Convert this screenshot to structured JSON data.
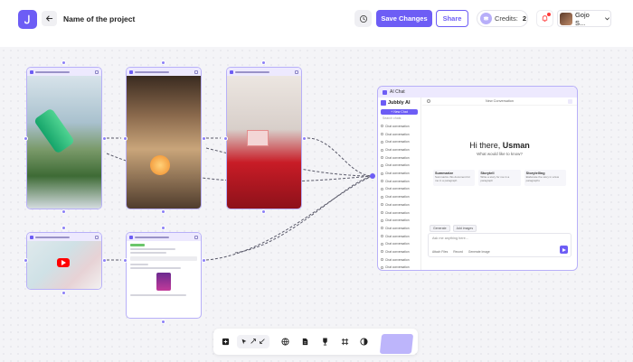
{
  "header": {
    "project_name": "Name of the project",
    "save_label": "Save Changes",
    "share_label": "Share",
    "credits_label": "Credits:",
    "credits_value": "2",
    "user_name": "Gojo S...",
    "accent": "#6d5df5"
  },
  "chat": {
    "panel_title": "AI Chat",
    "brand": "Jubbly AI",
    "new_chat": "+ New Chat",
    "search": "Search chats",
    "conversation_title": "New Conversation",
    "greeting_prefix": "Hi there, ",
    "greeting_name": "Usman",
    "greeting_sub": "What would like to know?",
    "cards": [
      {
        "title": "Summarize",
        "desc": "Summarize this document for me in a paragraph"
      },
      {
        "title": "Storytell",
        "desc": "Write a story for me in a paragraph"
      },
      {
        "title": "Storytelling",
        "desc": "Elaborate the story in a few paragraphs"
      }
    ],
    "chips": [
      "Generate",
      "Add images"
    ],
    "input_placeholder": "Ask me anything here...",
    "options": [
      "Attach Files",
      "Record",
      "Generate Image"
    ],
    "history_items": [
      "Chat conversation",
      "Chat conversation",
      "Chat conversation",
      "Chat conversation",
      "Chat conversation",
      "Chat conversation",
      "Chat conversation",
      "Chat conversation",
      "Chat conversation",
      "Chat conversation",
      "Chat conversation",
      "Chat conversation",
      "Chat conversation",
      "Chat conversation",
      "Chat conversation",
      "Chat conversation",
      "Chat conversation",
      "Chat conversation",
      "Chat conversation",
      "Chat conversation",
      "Chat conversation"
    ]
  },
  "icons": [
    "logo-icon",
    "back-arrow-icon",
    "history-icon",
    "coin-icon",
    "bell-icon",
    "chevron-down-icon",
    "external-link-icon",
    "play-icon",
    "send-icon"
  ]
}
